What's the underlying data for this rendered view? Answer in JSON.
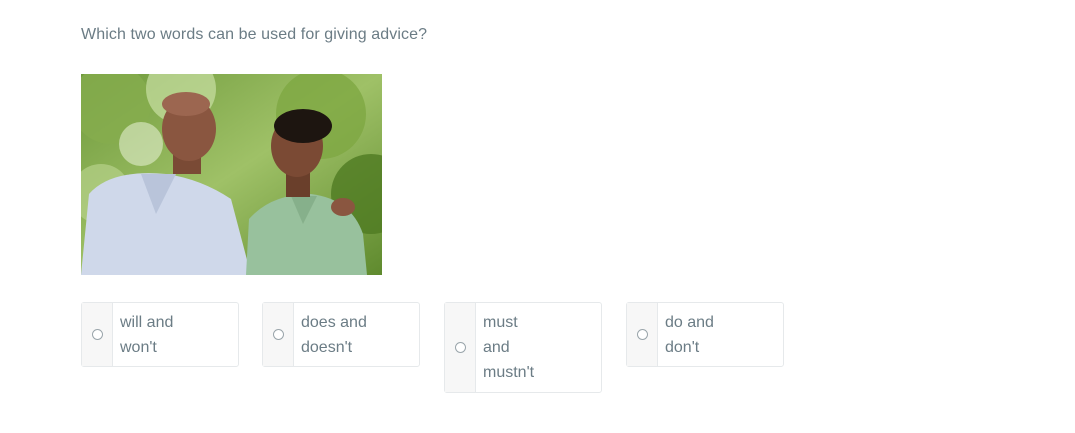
{
  "question": {
    "text": "Which two words can be used for giving advice?"
  },
  "image": {
    "alt": "Father and son talking outdoors"
  },
  "options": [
    {
      "lines": [
        "will and",
        "won't"
      ]
    },
    {
      "lines": [
        "does and",
        "doesn't"
      ]
    },
    {
      "lines": [
        "must",
        "and",
        "mustn't"
      ]
    },
    {
      "lines": [
        "do and",
        "don't"
      ]
    }
  ],
  "colors": {
    "text": "#6b7c85",
    "border": "#e6e9eb",
    "radio_bg": "#f7f7f7"
  }
}
